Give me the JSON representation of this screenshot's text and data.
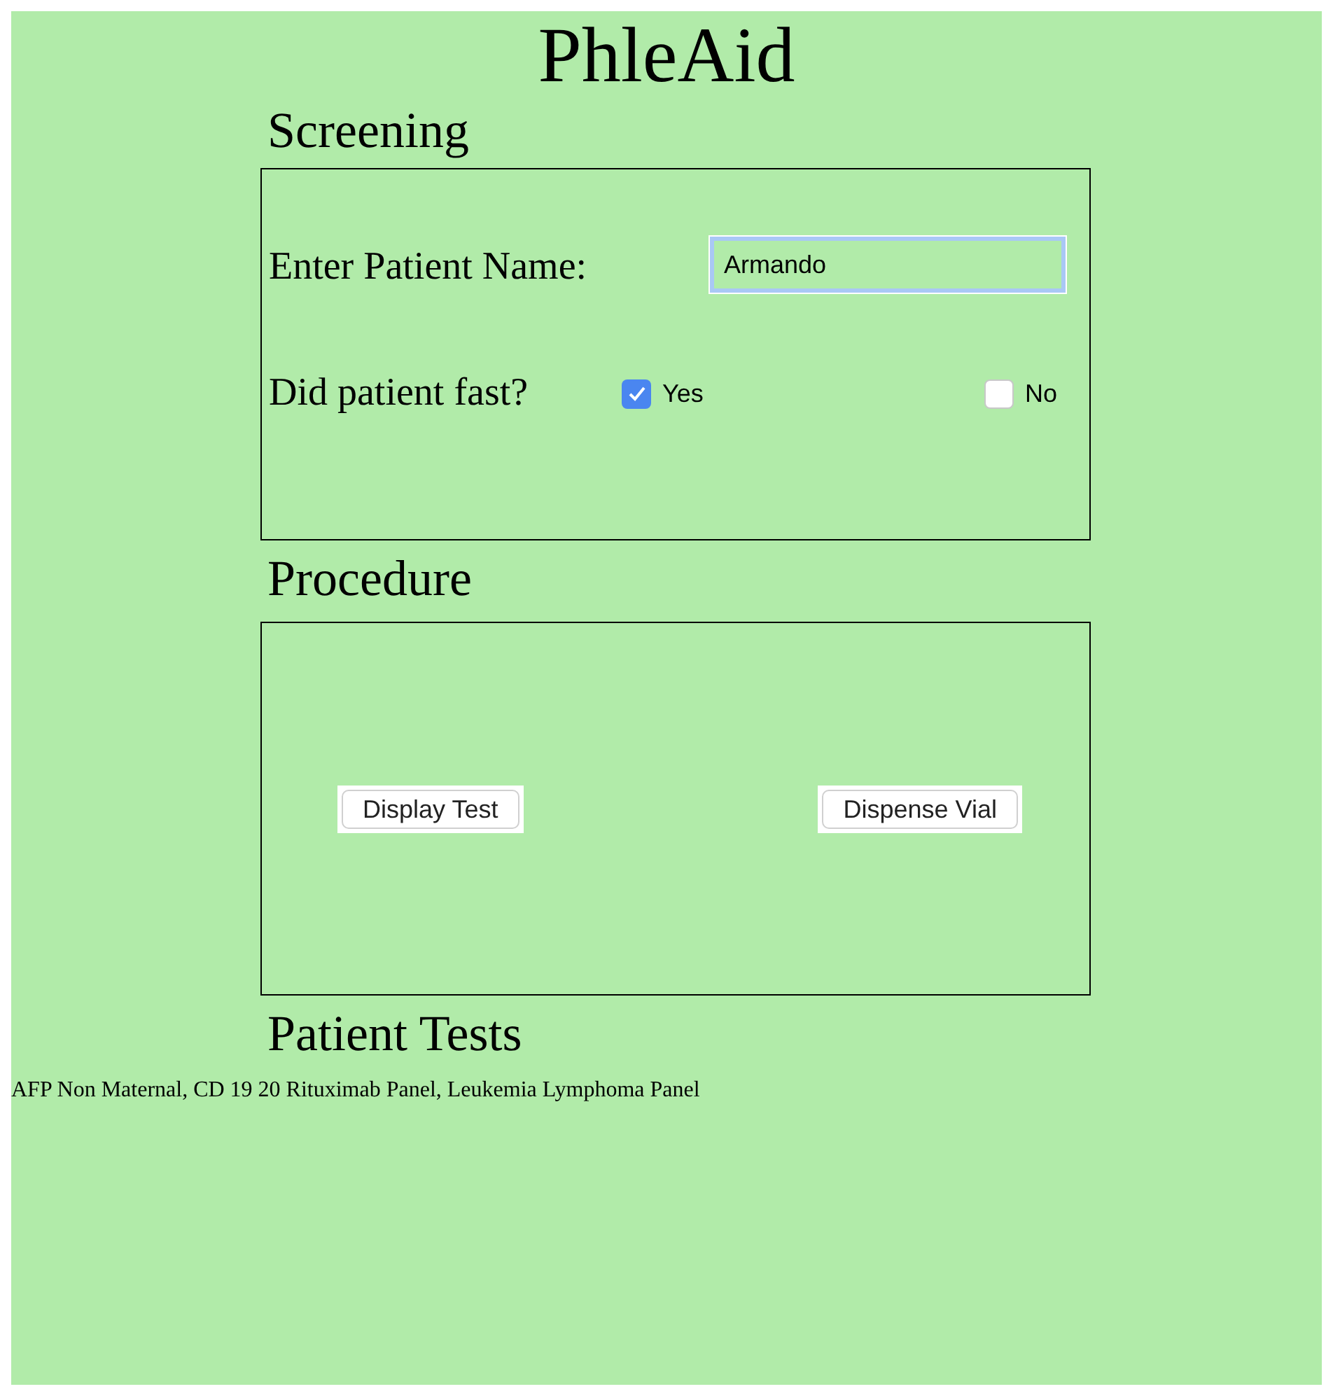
{
  "title": "PhleAid",
  "screening": {
    "heading": "Screening",
    "name_label": "Enter Patient Name:",
    "name_value": "Armando",
    "fast_label": "Did patient fast?",
    "fast_options": [
      {
        "label": "Yes",
        "checked": true
      },
      {
        "label": "No",
        "checked": false
      }
    ]
  },
  "procedure": {
    "heading": "Procedure",
    "buttons": [
      "Display Test",
      "Dispense Vial"
    ]
  },
  "patient_tests": {
    "heading": "Patient Tests",
    "text": "AFP Non Maternal, CD 19 20 Rituximab Panel, Leukemia Lymphoma Panel"
  }
}
